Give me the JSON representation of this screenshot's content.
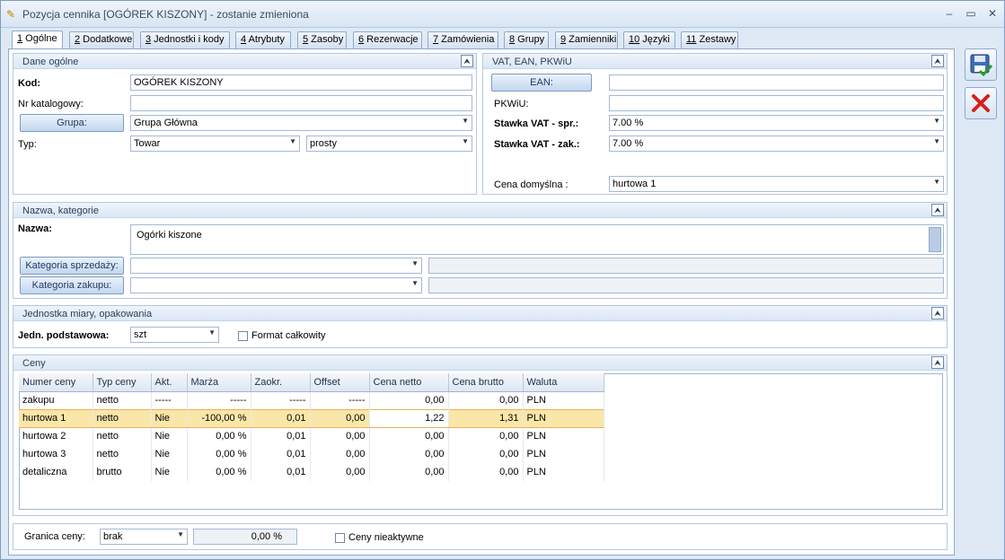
{
  "window": {
    "title": "Pozycja cennika [OGÓREK KISZONY] - zostanie zmieniona"
  },
  "tabs": [
    {
      "num": "1",
      "label": " Ogólne"
    },
    {
      "num": "2",
      "label": " Dodatkowe"
    },
    {
      "num": "3",
      "label": " Jednostki i kody"
    },
    {
      "num": "4",
      "label": " Atrybuty"
    },
    {
      "num": "5",
      "label": " Zasoby"
    },
    {
      "num": "6",
      "label": " Rezerwacje"
    },
    {
      "num": "7",
      "label": " Zamówienia"
    },
    {
      "num": "8",
      "label": " Grupy"
    },
    {
      "num": "9",
      "label": " Zamienniki"
    },
    {
      "num": "10",
      "label": " Języki"
    },
    {
      "num": "11",
      "label": " Zestawy"
    }
  ],
  "general": {
    "header": "Dane ogólne",
    "kod_label": "Kod:",
    "kod_value": "OGÓREK KISZONY",
    "nrkat_label": "Nr katalogowy:",
    "nrkat_value": "",
    "grupa_button": "Grupa:",
    "grupa_value": "Grupa Główna",
    "typ_label": "Typ:",
    "typ_value": "Towar",
    "typ2_value": "prosty"
  },
  "vat": {
    "header": "VAT, EAN, PKWiU",
    "ean_button": "EAN:",
    "ean_value": "",
    "pkwiu_label": "PKWiU:",
    "pkwiu_value": "",
    "vat_spr_label": "Stawka VAT - spr.:",
    "vat_spr_value": "7.00  %",
    "vat_zak_label": "Stawka VAT - zak.:",
    "vat_zak_value": "7.00  %",
    "cena_dom_label": "Cena domyślna :",
    "cena_dom_value": "hurtowa 1"
  },
  "name": {
    "header": "Nazwa, kategorie",
    "nazwa_label": "Nazwa:",
    "nazwa_value": "Ogórki kiszone",
    "kat_sprz_button": "Kategoria sprzedaży:",
    "kat_sprz_value": "",
    "kat_zak_button": "Kategoria zakupu:",
    "kat_zak_value": ""
  },
  "unit": {
    "header": "Jednostka miary, opakowania",
    "jedn_label": "Jedn. podstawowa:",
    "jedn_value": "szt",
    "format_label": "Format całkowity"
  },
  "prices": {
    "header": "Ceny",
    "columns": [
      "Numer ceny",
      "Typ ceny",
      "Akt.",
      "Marża",
      "Zaokr.",
      "Offset",
      "Cena netto",
      "Cena brutto",
      "Waluta"
    ],
    "rows": [
      [
        "zakupu",
        "netto",
        "-----",
        "-----",
        "-----",
        "-----",
        "0,00",
        "0,00",
        "PLN"
      ],
      [
        "hurtowa 1",
        "netto",
        "Nie",
        "-100,00 %",
        "0,01",
        "0,00",
        "1,22",
        "1,31",
        "PLN"
      ],
      [
        "hurtowa 2",
        "netto",
        "Nie",
        "0,00 %",
        "0,01",
        "0,00",
        "0,00",
        "0,00",
        "PLN"
      ],
      [
        "hurtowa 3",
        "netto",
        "Nie",
        "0,00 %",
        "0,01",
        "0,00",
        "0,00",
        "0,00",
        "PLN"
      ],
      [
        "detaliczna",
        "brutto",
        "Nie",
        "0,00 %",
        "0,01",
        "0,00",
        "0,00",
        "0,00",
        "PLN"
      ]
    ],
    "selected_row": 1
  },
  "bottom": {
    "granica_label": "Granica ceny:",
    "granica_value": "brak",
    "granica_pct": "0,00 %",
    "nieaktywne_label": "Ceny nieaktywne"
  },
  "icons": {
    "save": "save-check-icon",
    "cancel": "red-x-icon"
  }
}
